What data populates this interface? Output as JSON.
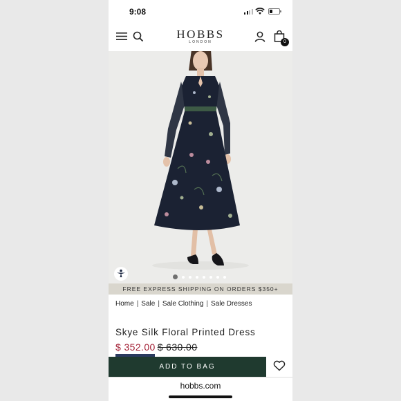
{
  "status_bar": {
    "time": "9:08"
  },
  "header": {
    "brand": "HOBBS",
    "brand_sub": "LONDON",
    "bag_count": "0",
    "icons": [
      "hamburger-menu-icon",
      "search-icon",
      "user-account-icon",
      "shopping-bag-icon"
    ]
  },
  "gallery": {
    "image_count": 8,
    "active_index": 0
  },
  "shipping_banner": "FREE EXPRESS SHIPPING ON ORDERS $350+",
  "breadcrumb": {
    "items": [
      "Home",
      "Sale",
      "Sale Clothing",
      "Sale Dresses"
    ],
    "separator": "|"
  },
  "product": {
    "title": "Skye Silk Floral Printed Dress",
    "price_now": "$ 352.00",
    "price_was": "$ 630.00"
  },
  "actions": {
    "add_to_bag": "ADD TO BAG"
  },
  "browser": {
    "url": "hobbs.com"
  },
  "colors": {
    "price_sale": "#a32035",
    "cta_background": "#1f3a2f",
    "banner_background": "#d9d6cd",
    "dress": "#1b2233"
  }
}
